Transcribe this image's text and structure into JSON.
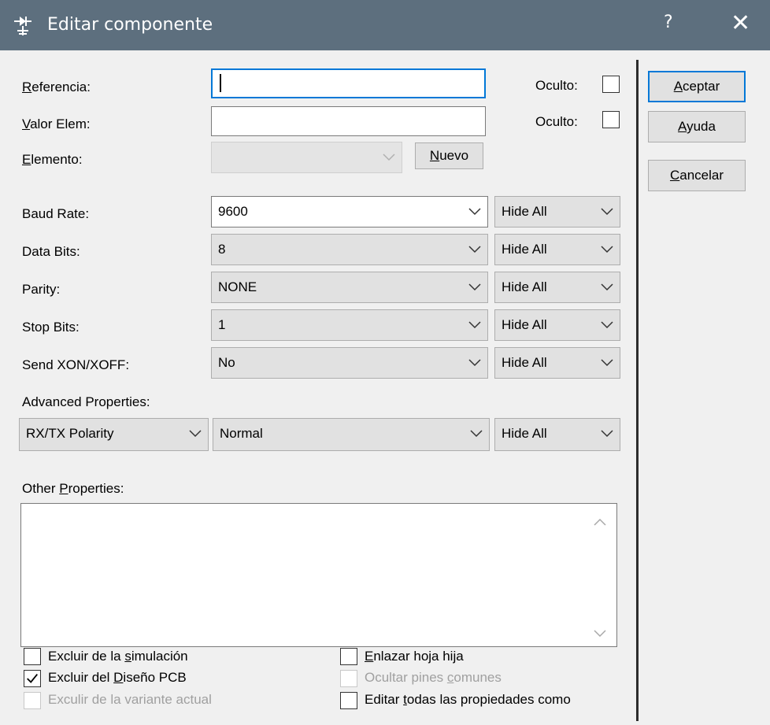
{
  "window": {
    "title": "Editar componente",
    "help_label": "?",
    "close_label": "✕"
  },
  "fields": {
    "referencia_label": "Referencia:",
    "referencia_value": "",
    "valor_label": "Valor Elem:",
    "valor_value": "",
    "elemento_label": "Elemento:",
    "elemento_value": "",
    "oculto_label": "Oculto:",
    "nuevo_button": "Nuevo"
  },
  "buttons": {
    "aceptar": "Aceptar",
    "ayuda": "Ayuda",
    "cancelar": "Cancelar"
  },
  "properties": [
    {
      "label": "Baud Rate:",
      "value": "9600",
      "visibility": "Hide All"
    },
    {
      "label": "Data Bits:",
      "value": "8",
      "visibility": "Hide All"
    },
    {
      "label": "Parity:",
      "value": "NONE",
      "visibility": "Hide All"
    },
    {
      "label": "Stop Bits:",
      "value": "1",
      "visibility": "Hide All"
    },
    {
      "label": "Send XON/XOFF:",
      "value": "No",
      "visibility": "Hide All"
    }
  ],
  "advanced": {
    "label": "Advanced Properties:",
    "property": "RX/TX Polarity",
    "value": "Normal",
    "visibility": "Hide All"
  },
  "other": {
    "label": "Other Properties:",
    "value": ""
  },
  "checkboxes": {
    "excluir_simulacion": {
      "label": "Excluir de la simulación",
      "checked": false
    },
    "excluir_pcb": {
      "label": "Excluir del Diseño PCB",
      "checked": true
    },
    "excluir_variante": {
      "label": "Exculir de la variante actual",
      "checked": false,
      "disabled": true
    },
    "enlazar_hoja": {
      "label": "Enlazar hoja hija",
      "checked": false
    },
    "ocultar_pines": {
      "label": "Ocultar pines comunes",
      "checked": false,
      "disabled": true
    },
    "editar_todas": {
      "label": "Editar todas las propiedades como",
      "checked": false
    }
  },
  "colors": {
    "titlebar": "#5d6f7e",
    "focus": "#0078d7",
    "background": "#f0f0f0"
  }
}
